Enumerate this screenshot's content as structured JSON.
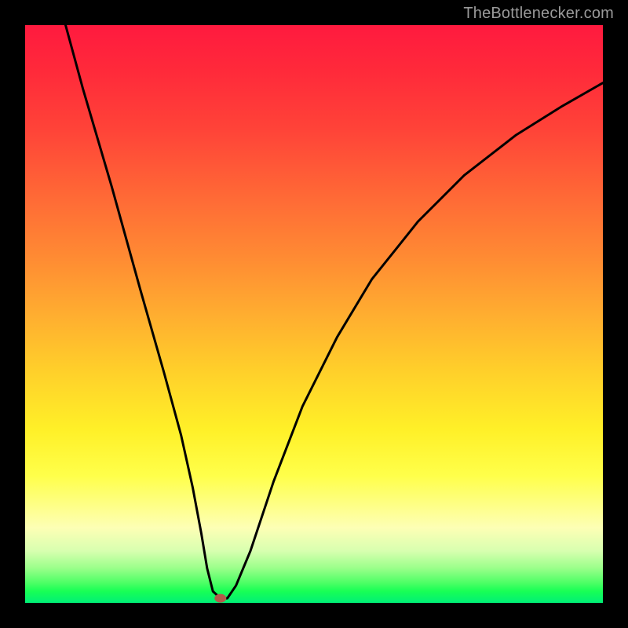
{
  "watermark": {
    "text": "TheBottlenecker.com"
  },
  "chart_data": {
    "type": "line",
    "title": "",
    "xlabel": "",
    "ylabel": "",
    "xlim": [
      0,
      100
    ],
    "ylim": [
      0,
      100
    ],
    "series": [
      {
        "name": "bottleneck-curve",
        "x": [
          7,
          10,
          15,
          20,
          24,
          27,
          29,
          30.5,
          31.5,
          32.5,
          33.8,
          35,
          36.5,
          39,
          43,
          48,
          54,
          60,
          68,
          76,
          85,
          93,
          100
        ],
        "y": [
          100,
          89,
          72,
          54,
          40,
          29,
          20,
          12,
          6,
          2,
          0.8,
          0.8,
          3,
          9,
          21,
          34,
          46,
          56,
          66,
          74,
          81,
          86,
          90
        ]
      }
    ],
    "marker": {
      "x": 33.8,
      "y": 0.8,
      "color": "#b35a4a"
    },
    "gradient_colors": {
      "top": "#ff1a3f",
      "mid": "#ffd02a",
      "bottom": "#00ef77"
    }
  }
}
